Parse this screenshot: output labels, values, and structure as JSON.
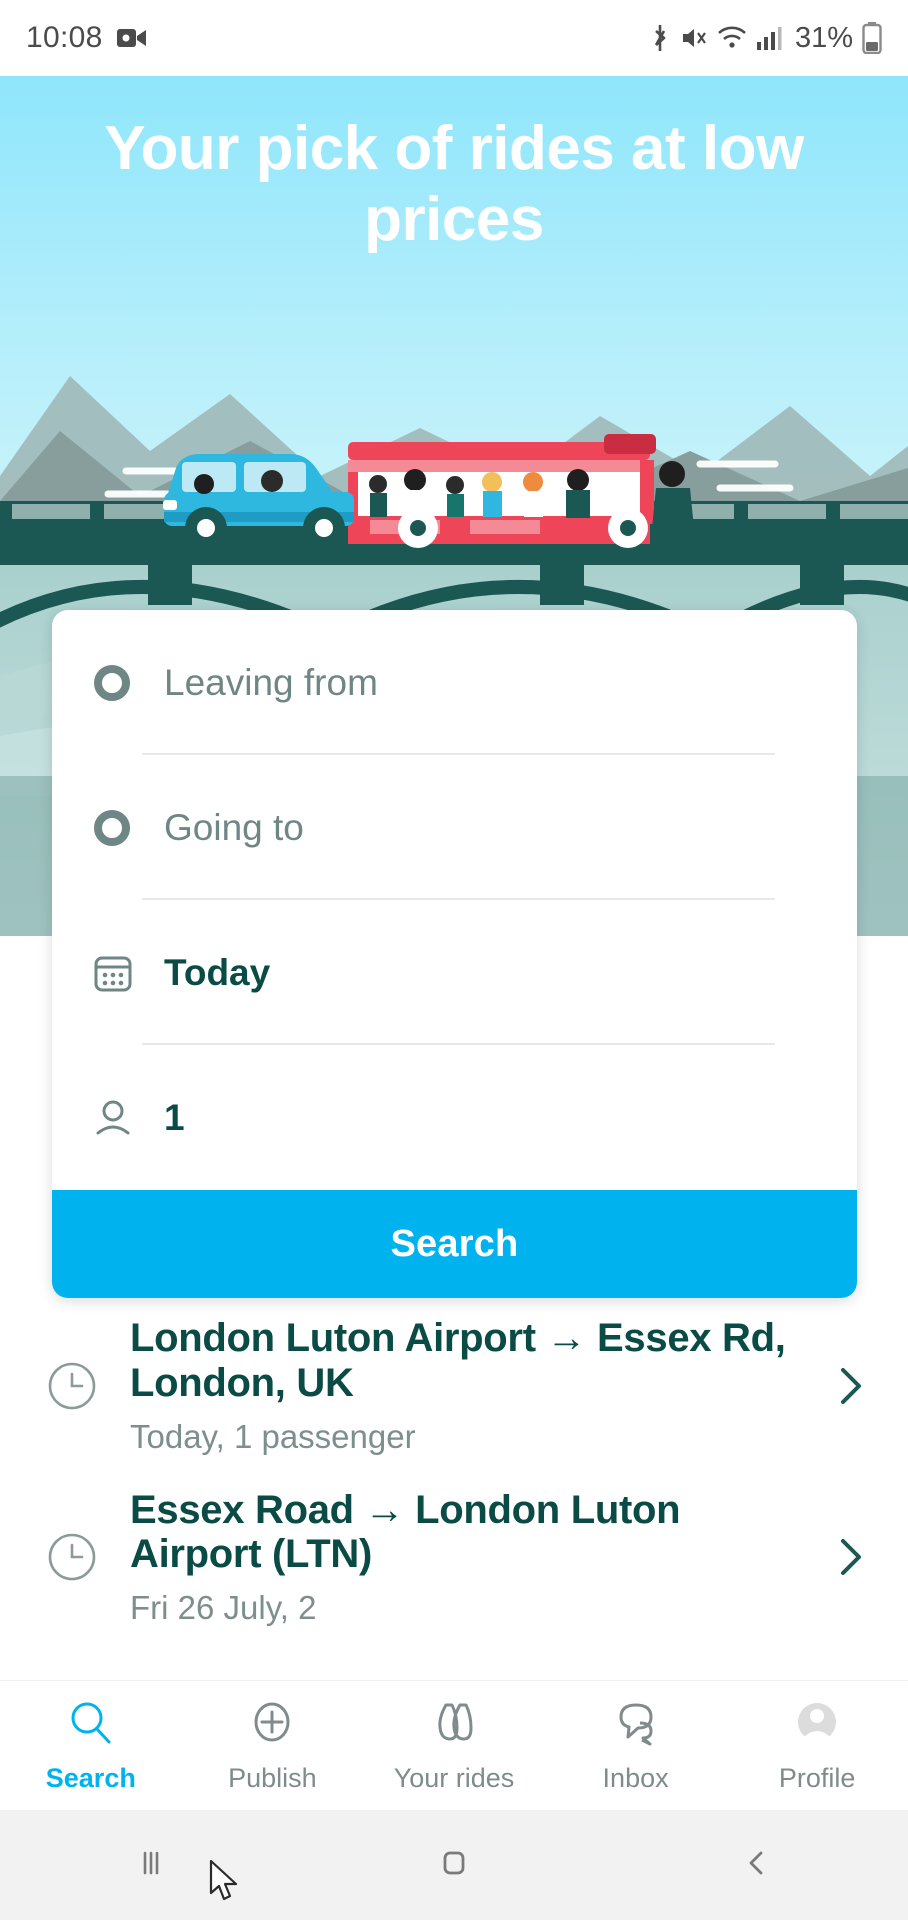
{
  "statusbar": {
    "time": "10:08",
    "battery_percent": "31%",
    "icons": [
      "video-recorder-icon",
      "bluetooth-icon",
      "mute-icon",
      "wifi-icon",
      "cellular-signal-icon",
      "battery-icon"
    ]
  },
  "hero": {
    "title": "Your pick of rides at low prices",
    "illustration": "carpool-bus-bridge-illustration",
    "colors": {
      "sky": "#a7eafb",
      "mountain": "#7f9c9a",
      "bridge": "#1c5853",
      "car": "#2eb8e0",
      "bus": "#ef4559"
    }
  },
  "search_card": {
    "fields": [
      {
        "name": "leaving-from",
        "icon": "circle-outline-icon",
        "placeholder": "Leaving from",
        "value": "",
        "filled": false
      },
      {
        "name": "going-to",
        "icon": "circle-outline-icon",
        "placeholder": "Going to",
        "value": "",
        "filled": false
      },
      {
        "name": "date",
        "icon": "calendar-icon",
        "placeholder": "Today",
        "value": "Today",
        "filled": true
      },
      {
        "name": "passengers",
        "icon": "person-icon",
        "placeholder": "1",
        "value": "1",
        "filled": true
      }
    ],
    "search_label": "Search",
    "accent_color": "#00b3ef"
  },
  "recent_searches": [
    {
      "icon": "clock-icon",
      "title": "London Luton Airport → Essex Rd, London, UK",
      "subtitle": "Today, 1 passenger",
      "chevron": "chevron-right-icon"
    },
    {
      "icon": "clock-icon",
      "title": "Essex Road → London Luton Airport (LTN)",
      "subtitle": "Fri 26 July, 2",
      "chevron": "chevron-right-icon"
    }
  ],
  "bottom_nav": {
    "items": [
      {
        "label": "Search",
        "icon": "search-icon",
        "active": true
      },
      {
        "label": "Publish",
        "icon": "plus-circle-icon",
        "active": false
      },
      {
        "label": "Your rides",
        "icon": "rides-icon",
        "active": false
      },
      {
        "label": "Inbox",
        "icon": "chat-bubble-icon",
        "active": false
      },
      {
        "label": "Profile",
        "icon": "avatar-icon",
        "active": false
      }
    ],
    "active_color": "#00b3ef",
    "inactive_color": "#7f8c8b"
  },
  "android_nav": {
    "buttons": [
      {
        "name": "recents-button",
        "icon": "recents-icon"
      },
      {
        "name": "home-button",
        "icon": "home-square-icon"
      },
      {
        "name": "back-button",
        "icon": "back-chevron-icon"
      }
    ]
  }
}
